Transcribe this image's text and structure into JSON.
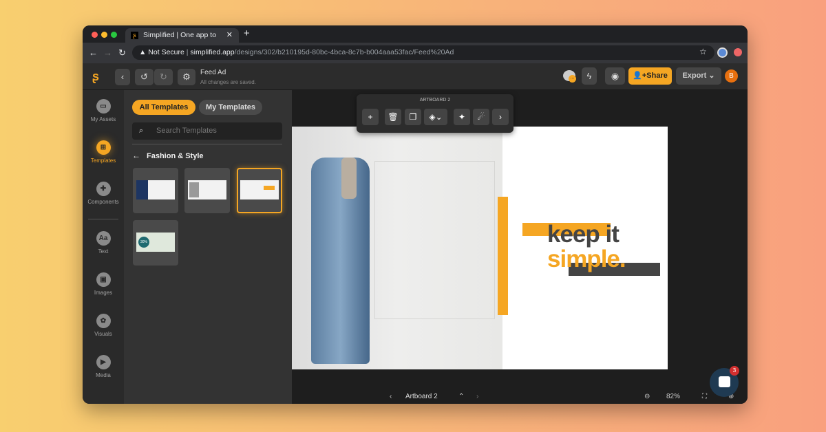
{
  "browser": {
    "tab_title": "Simplified | One app to design,",
    "not_secure": "Not Secure",
    "url_host": "simplified.app",
    "url_path": "/designs/302/b210195d-80bc-4bca-8c7b-b004aaa53fac/Feed%20Ad"
  },
  "header": {
    "doc_title": "Feed Ad",
    "save_status": "All changes are saved.",
    "share_label": "Share",
    "export_label": "Export",
    "avatar_initial": "B"
  },
  "rail": {
    "items": [
      {
        "label": "My Assets",
        "icon": "folder-icon"
      },
      {
        "label": "Templates",
        "icon": "templates-icon",
        "active": true
      },
      {
        "label": "Components",
        "icon": "components-icon"
      },
      {
        "label": "Text",
        "icon": "text-icon",
        "glyph": "Aa"
      },
      {
        "label": "Images",
        "icon": "images-icon"
      },
      {
        "label": "Visuals",
        "icon": "visuals-icon"
      },
      {
        "label": "Media",
        "icon": "media-icon"
      }
    ]
  },
  "panel": {
    "tab_all": "All Templates",
    "tab_my": "My Templates",
    "search_placeholder": "Search Templates",
    "category": "Fashion & Style",
    "thumb_badge": "30%"
  },
  "toolbar": {
    "title": "ARTBOARD 2"
  },
  "artboard": {
    "line1": "keep it",
    "line2": "simple."
  },
  "bottom": {
    "artboard_name": "Artboard 2",
    "zoom": "82%"
  },
  "chat": {
    "badge": "3"
  },
  "colors": {
    "accent": "#f5a623",
    "dark": "#444444"
  }
}
